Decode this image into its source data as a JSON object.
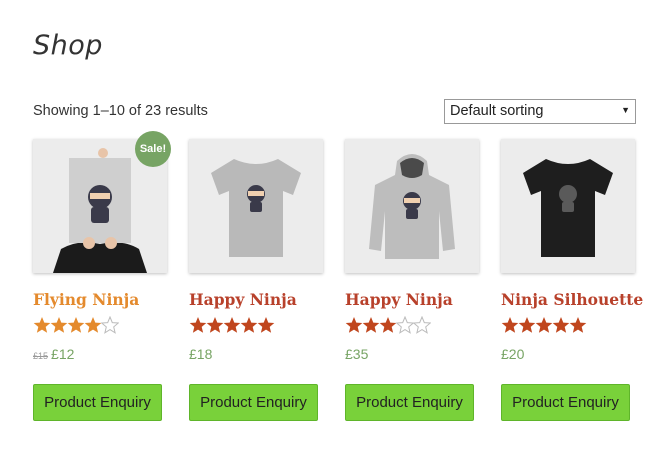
{
  "page": {
    "title": "Shop"
  },
  "toolbar": {
    "result_count": "Showing 1–10 of 23 results",
    "sort_selected": "Default sorting"
  },
  "colors": {
    "accent": "#77a464",
    "title": "#b8412b",
    "button": "#79d13a",
    "star": "#c0461e"
  },
  "products": [
    {
      "name": "Flying Ninja",
      "rating": 4,
      "old_price": "£15",
      "price": "£12",
      "sale_label": "Sale!",
      "button": "Product Enquiry",
      "image": "ninja-poster"
    },
    {
      "name": "Happy Ninja",
      "rating": 5,
      "price": "£18",
      "button": "Product Enquiry",
      "image": "ninja-tshirt-grey"
    },
    {
      "name": "Happy Ninja",
      "rating": 3,
      "price": "£35",
      "button": "Product Enquiry",
      "image": "ninja-hoodie-grey"
    },
    {
      "name": "Ninja Silhouette",
      "rating": 5,
      "price": "£20",
      "button": "Product Enquiry",
      "image": "ninja-tshirt-black"
    }
  ]
}
